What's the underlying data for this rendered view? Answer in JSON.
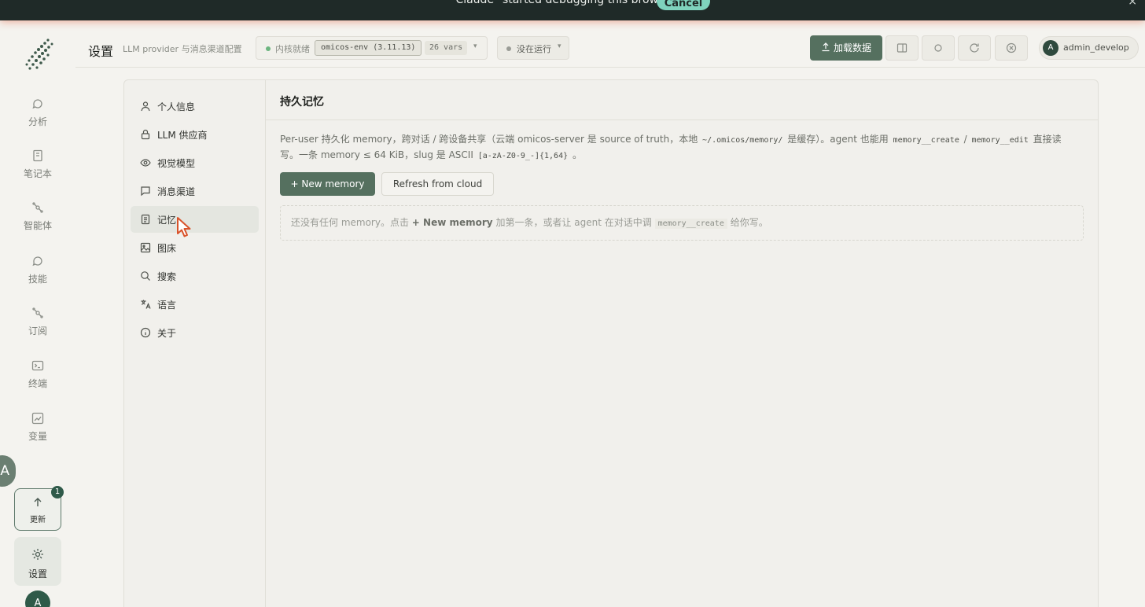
{
  "banner": {
    "text": "\"Claude\" started debugging this browser",
    "cancel": "Cancel",
    "close": "×"
  },
  "leftnav": {
    "items": [
      {
        "label": "分析",
        "icon": "chat-bubble-icon"
      },
      {
        "label": "笔记本",
        "icon": "notebook-icon"
      },
      {
        "label": "智能体",
        "icon": "agent-icon"
      },
      {
        "label": "技能",
        "icon": "chat-bubble-icon"
      },
      {
        "label": "订阅",
        "icon": "subscribe-icon"
      },
      {
        "label": "终端",
        "icon": "terminal-icon"
      },
      {
        "label": "变量",
        "icon": "chart-icon"
      }
    ],
    "translate": "A",
    "update": {
      "label": "更新",
      "badge": "1"
    },
    "settings": {
      "label": "设置"
    },
    "avatar": "A"
  },
  "header": {
    "title": "设置",
    "subtitle": "LLM provider 与消息渠道配置",
    "kernel": {
      "status": "内核就绪",
      "env": "omicos-env (3.11.13)",
      "vars": "26 vars",
      "caret": "▾"
    },
    "run": {
      "label": "没在运行",
      "caret": "▾"
    },
    "load_button": "加载数据",
    "user": {
      "initial": "A",
      "name": "admin_develop"
    }
  },
  "settings_nav": {
    "items": [
      {
        "label": "个人信息",
        "icon": "user-icon"
      },
      {
        "label": "LLM 供应商",
        "icon": "lock-icon"
      },
      {
        "label": "视觉模型",
        "icon": "eye-icon"
      },
      {
        "label": "消息渠道",
        "icon": "message-icon"
      },
      {
        "label": "记忆",
        "icon": "document-icon",
        "active": true
      },
      {
        "label": "图床",
        "icon": "image-icon"
      },
      {
        "label": "搜索",
        "icon": "search-icon"
      },
      {
        "label": "语言",
        "icon": "language-icon"
      },
      {
        "label": "关于",
        "icon": "info-icon"
      }
    ]
  },
  "memory": {
    "title": "持久记忆",
    "desc_part1": "Per-user 持久化 memory，跨对话 / 跨设备共享（云端 omicos-server 是 source of truth，本地",
    "desc_code1": "~/.omicos/memory/",
    "desc_part2": "是缓存）。agent 也能用",
    "desc_code2": "memory__create",
    "desc_sep": "/",
    "desc_code3": "memory__edit",
    "desc_part3": "直接读写。一条 memory ≤ 64 KiB，slug 是 ASCII",
    "desc_code4": "[a-zA-Z0-9_-]{1,64}",
    "desc_part4": "。",
    "new_button": "+ New memory",
    "refresh_button": "Refresh from cloud",
    "empty_part1": "还没有任何 memory。点击",
    "empty_bold": "+ New memory",
    "empty_part2": "加第一条，或者让 agent 在对话中调",
    "empty_code": "memory__create",
    "empty_part3": "给你写。"
  }
}
